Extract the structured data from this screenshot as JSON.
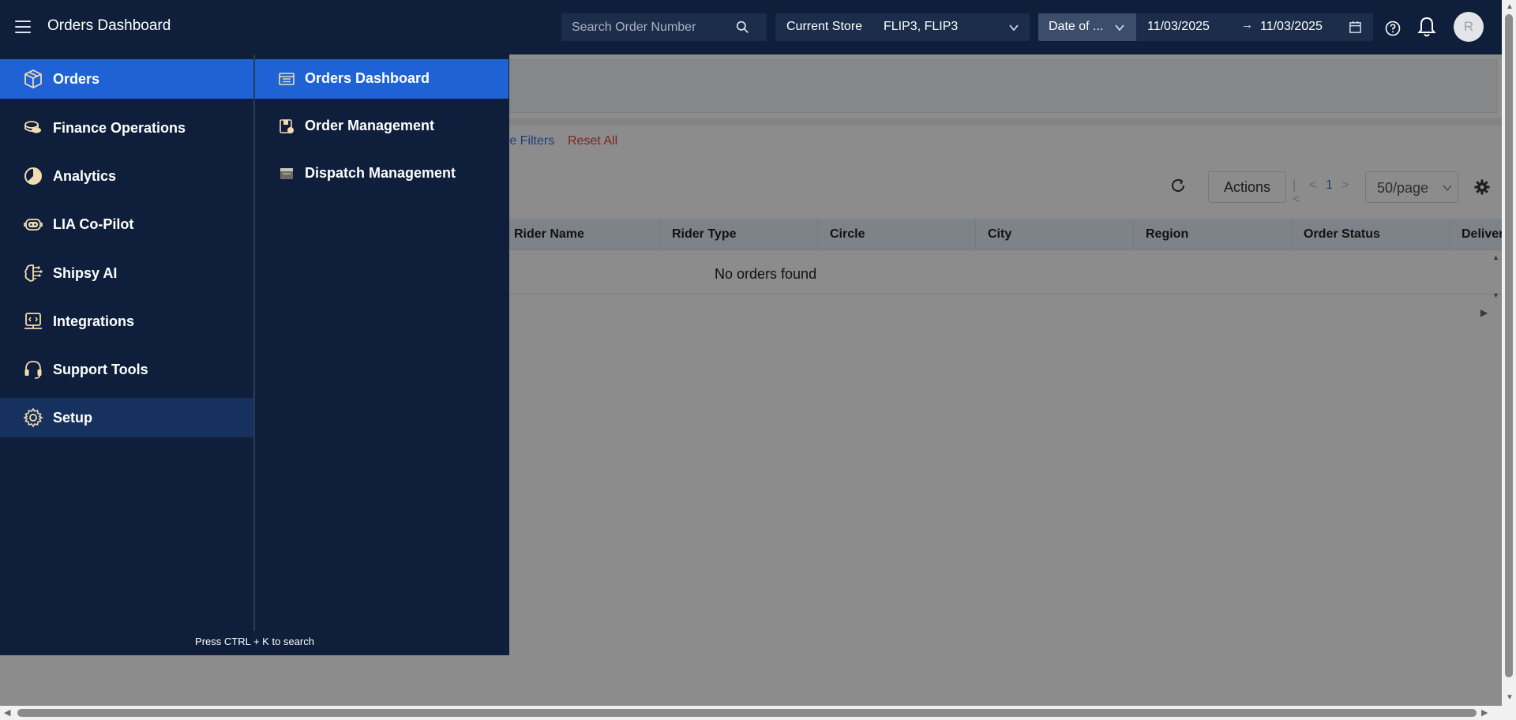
{
  "header": {
    "title": "Orders Dashboard",
    "search_placeholder": "Search Order Number",
    "store_label": "Current Store",
    "store_value": "FLIP3, FLIP3",
    "date_type": "Date of ...",
    "date_from": "11/03/2025",
    "date_to": "11/03/2025",
    "avatar_initial": "R"
  },
  "page": {
    "more_filters": "re Filters",
    "reset_all": "Reset All",
    "actions_label": "Actions",
    "pager_current": "1",
    "page_size": "50/page",
    "columns": [
      "Rider Name",
      "Rider Type",
      "Circle",
      "City",
      "Region",
      "Order Status",
      "Deliver"
    ],
    "empty_message": "No orders found"
  },
  "menu": {
    "items": [
      {
        "label": "Orders",
        "icon": "box-icon"
      },
      {
        "label": "Finance Operations",
        "icon": "coins-icon"
      },
      {
        "label": "Analytics",
        "icon": "pie-chart-icon"
      },
      {
        "label": "LIA Co-Pilot",
        "icon": "robot-icon"
      },
      {
        "label": "Shipsy AI",
        "icon": "ai-brain-icon"
      },
      {
        "label": "Integrations",
        "icon": "integration-icon"
      },
      {
        "label": "Support Tools",
        "icon": "headset-icon"
      },
      {
        "label": "Setup",
        "icon": "gear-icon"
      }
    ],
    "sub_items": [
      {
        "label": "Orders Dashboard",
        "icon": "dashboard-list-icon"
      },
      {
        "label": "Order Management",
        "icon": "order-management-icon"
      },
      {
        "label": "Dispatch Management",
        "icon": "dispatch-icon"
      }
    ],
    "hint": "Press CTRL + K to search"
  },
  "colors": {
    "header_bg": "#0f1e3a",
    "active_blue": "#1f62d6",
    "setup_highlight": "#17315f",
    "icon_cream": "#f2ddb0"
  }
}
